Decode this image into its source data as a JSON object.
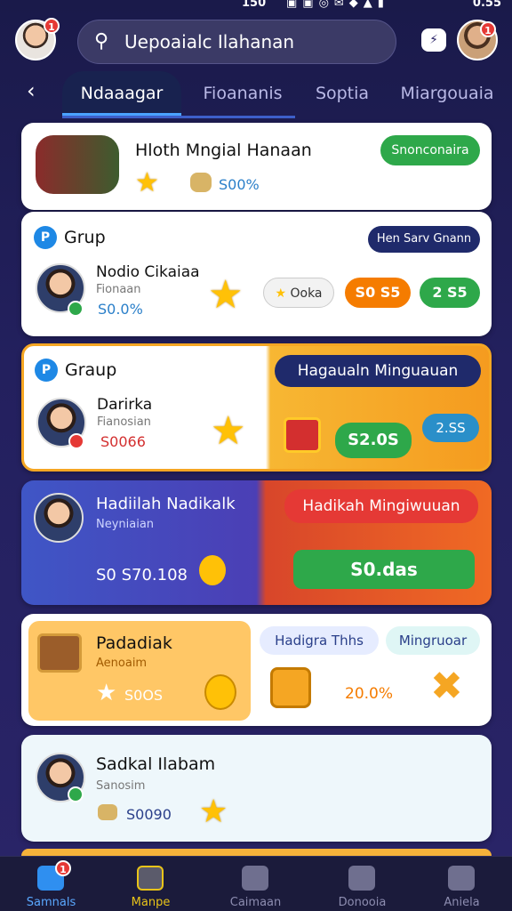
{
  "status": {
    "time": "150",
    "battery": "0.55"
  },
  "header": {
    "search_text": "Uepoaialc Ilahanan",
    "left_badge": "1",
    "right_badge": "1"
  },
  "tabs": [
    {
      "label": "Ndaaagar",
      "active": true
    },
    {
      "label": "Fioananis"
    },
    {
      "label": "Soptia"
    },
    {
      "label": "Miargouaia"
    }
  ],
  "cards": {
    "c1": {
      "title": "Hloth Mngial Hanaan",
      "amount": "S00%",
      "button": "Snonconaira"
    },
    "c2": {
      "group": "Grup",
      "pill": "Hen Sarv Gnann",
      "name": "Nodio Cikaiaa",
      "sub": "Fionaan",
      "amount": "S0.0%",
      "btn1": "Ooka",
      "btn2": "S0 S5",
      "btn3": "2 S5"
    },
    "c3": {
      "group": "Graup",
      "banner": "Hagaualn Minguauan",
      "name": "Darirka",
      "sub": "Fianosian",
      "amount": "S0066",
      "btn1": "S2.0S",
      "btn2": "2.SS"
    },
    "c4": {
      "name": "Hadiilah Nadikalk",
      "sub": "Neyniaian",
      "amount": "S0 S70.108",
      "banner": "Hadikah Mingiwuuan",
      "button": "S0.das"
    },
    "c5": {
      "name": "Padadiak",
      "sub": "Aenoaim",
      "amount": "S0OS",
      "chip1": "Hadigra Thhs",
      "chip2": "Mingruoar",
      "percent": "20.0%"
    },
    "c6": {
      "name": "Sadkal Ilabam",
      "sub": "Sanosim",
      "amount": "S0090"
    }
  },
  "nav": [
    {
      "label": "Samnals",
      "active": true,
      "badge": "1"
    },
    {
      "label": "Manpe"
    },
    {
      "label": "Caimaan"
    },
    {
      "label": "Donooia"
    },
    {
      "label": "Aniela"
    }
  ],
  "colors": {
    "green": "#2ea84a",
    "orange": "#f57c00",
    "navy": "#1f2a6b",
    "gold": "#ffc107"
  }
}
